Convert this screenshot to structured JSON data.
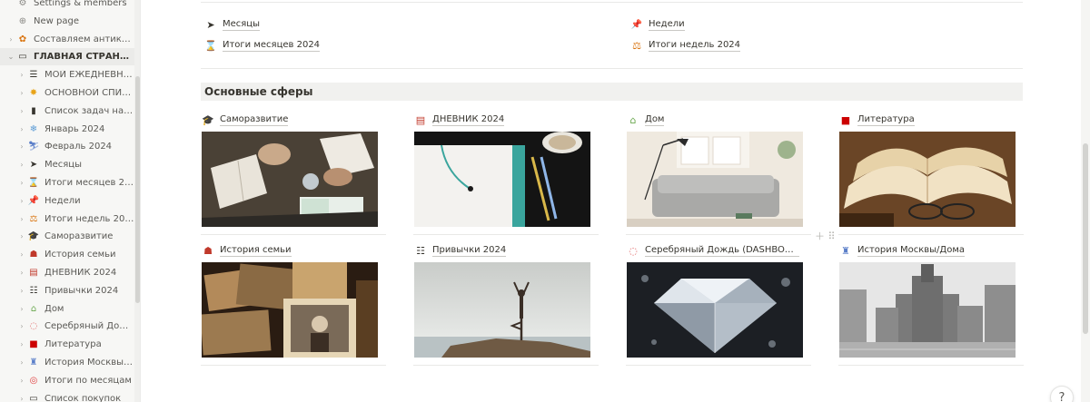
{
  "sidebar": {
    "items": [
      {
        "label": "Settings & members",
        "icon": "⚙",
        "icon_name": "gear-icon",
        "icon_color": "#8a8985"
      },
      {
        "label": "New page",
        "icon": "⊕",
        "icon_name": "plus-circle-icon",
        "icon_color": "#8a8985"
      },
      {
        "label": "Составляем антикр…",
        "icon": "✿",
        "icon_name": "flower-icon",
        "icon_color": "#d9730d"
      },
      {
        "label": "ГЛАВНАЯ СТРАНИ…",
        "icon": "▭",
        "icon_name": "laptop-icon",
        "icon_color": "#37352f"
      },
      {
        "label": "МОЙ ЕЖЕДНЕВН…",
        "icon": "☰",
        "icon_name": "checklist-icon",
        "icon_color": "#37352f"
      },
      {
        "label": "ОСНОВНОЙ СПИ…",
        "icon": "✸",
        "icon_name": "star-icon",
        "icon_color": "#e8a317"
      },
      {
        "label": "Список задач на …",
        "icon": "▮",
        "icon_name": "book-icon",
        "icon_color": "#37352f"
      },
      {
        "label": "Январь 2024",
        "icon": "❄",
        "icon_name": "snowflake-icon",
        "icon_color": "#5b9bd5"
      },
      {
        "label": "Февраль 2024",
        "icon": "⛷",
        "icon_name": "skier-icon",
        "icon_color": "#5b7fc9"
      },
      {
        "label": "Месяцы",
        "icon": "➤",
        "icon_name": "send-arrow-icon",
        "icon_color": "#37352f"
      },
      {
        "label": "Итоги месяцев 2…",
        "icon": "⌛",
        "icon_name": "hourglass-icon",
        "icon_color": "#c9a227"
      },
      {
        "label": "Недели",
        "icon": "📌",
        "icon_name": "pushpin-icon",
        "icon_color": "#e03e3e"
      },
      {
        "label": "Итоги недель 2024",
        "icon": "⚖",
        "icon_name": "scales-icon",
        "icon_color": "#d9730d"
      },
      {
        "label": "Саморазвитие",
        "icon": "🎓",
        "icon_name": "graduation-cap-icon",
        "icon_color": "#37352f"
      },
      {
        "label": "История семьи",
        "icon": "☗",
        "icon_name": "family-icon",
        "icon_color": "#c0392b"
      },
      {
        "label": "ДНЕВНИК 2024",
        "icon": "▤",
        "icon_name": "clipboard-icon",
        "icon_color": "#c0392b"
      },
      {
        "label": "Привычки 2024",
        "icon": "☷",
        "icon_name": "list-icon",
        "icon_color": "#37352f"
      },
      {
        "label": "Дом",
        "icon": "⌂",
        "icon_name": "house-icon",
        "icon_color": "#6aa84f"
      },
      {
        "label": "Серебряный До…",
        "icon": "◌",
        "icon_name": "speech-bubble-icon",
        "icon_color": "#e06666"
      },
      {
        "label": "Литература",
        "icon": "■",
        "icon_name": "red-book-icon",
        "icon_color": "#cc0000"
      },
      {
        "label": "История Москвы…",
        "icon": "♜",
        "icon_name": "building-icon",
        "icon_color": "#5b7fc9"
      },
      {
        "label": "Итоги по месяцам",
        "icon": "◎",
        "icon_name": "target-icon",
        "icon_color": "#e03e3e"
      },
      {
        "label": "Список покупок",
        "icon": "▭",
        "icon_name": "card-icon",
        "icon_color": "#37352f"
      }
    ]
  },
  "links": [
    {
      "label": "Месяцы",
      "icon": "➤",
      "icon_name": "send-arrow-icon",
      "icon_color": "#37352f"
    },
    {
      "label": "Недели",
      "icon": "📌",
      "icon_name": "pushpin-icon",
      "icon_color": "#e03e3e"
    },
    {
      "label": "Итоги месяцев 2024",
      "icon": "⌛",
      "icon_name": "hourglass-icon",
      "icon_color": "#c9a227"
    },
    {
      "label": "Итоги недель 2024",
      "icon": "⚖",
      "icon_name": "scales-icon",
      "icon_color": "#d9730d"
    }
  ],
  "section": {
    "title": "Основные сферы"
  },
  "cards": [
    {
      "title": "Саморазвитие",
      "icon": "🎓",
      "icon_name": "graduation-cap-icon",
      "icon_color": "#37352f",
      "cover": "study-table"
    },
    {
      "title": "ДНЕВНИК 2024",
      "icon": "▤",
      "icon_name": "clipboard-icon",
      "icon_color": "#c0392b",
      "cover": "notebook"
    },
    {
      "title": "Дом",
      "icon": "⌂",
      "icon_name": "house-icon",
      "icon_color": "#6aa84f",
      "cover": "living-room"
    },
    {
      "title": "Литература",
      "icon": "■",
      "icon_name": "red-book-icon",
      "icon_color": "#cc0000",
      "cover": "open-book"
    },
    {
      "title": "История семьи",
      "icon": "☗",
      "icon_name": "family-icon",
      "icon_color": "#c0392b",
      "cover": "old-photos"
    },
    {
      "title": "Привычки 2024",
      "icon": "☷",
      "icon_name": "list-icon",
      "icon_color": "#37352f",
      "cover": "yoga"
    },
    {
      "title": "Серебряный Дождь (DASHBOA…",
      "icon": "◌",
      "icon_name": "speech-bubble-icon",
      "icon_color": "#e06666",
      "cover": "diamond"
    },
    {
      "title": "История Москвы/Дома",
      "icon": "♜",
      "icon_name": "building-icon",
      "icon_color": "#5b7fc9",
      "cover": "moscow-bw"
    }
  ],
  "help": {
    "label": "?"
  }
}
